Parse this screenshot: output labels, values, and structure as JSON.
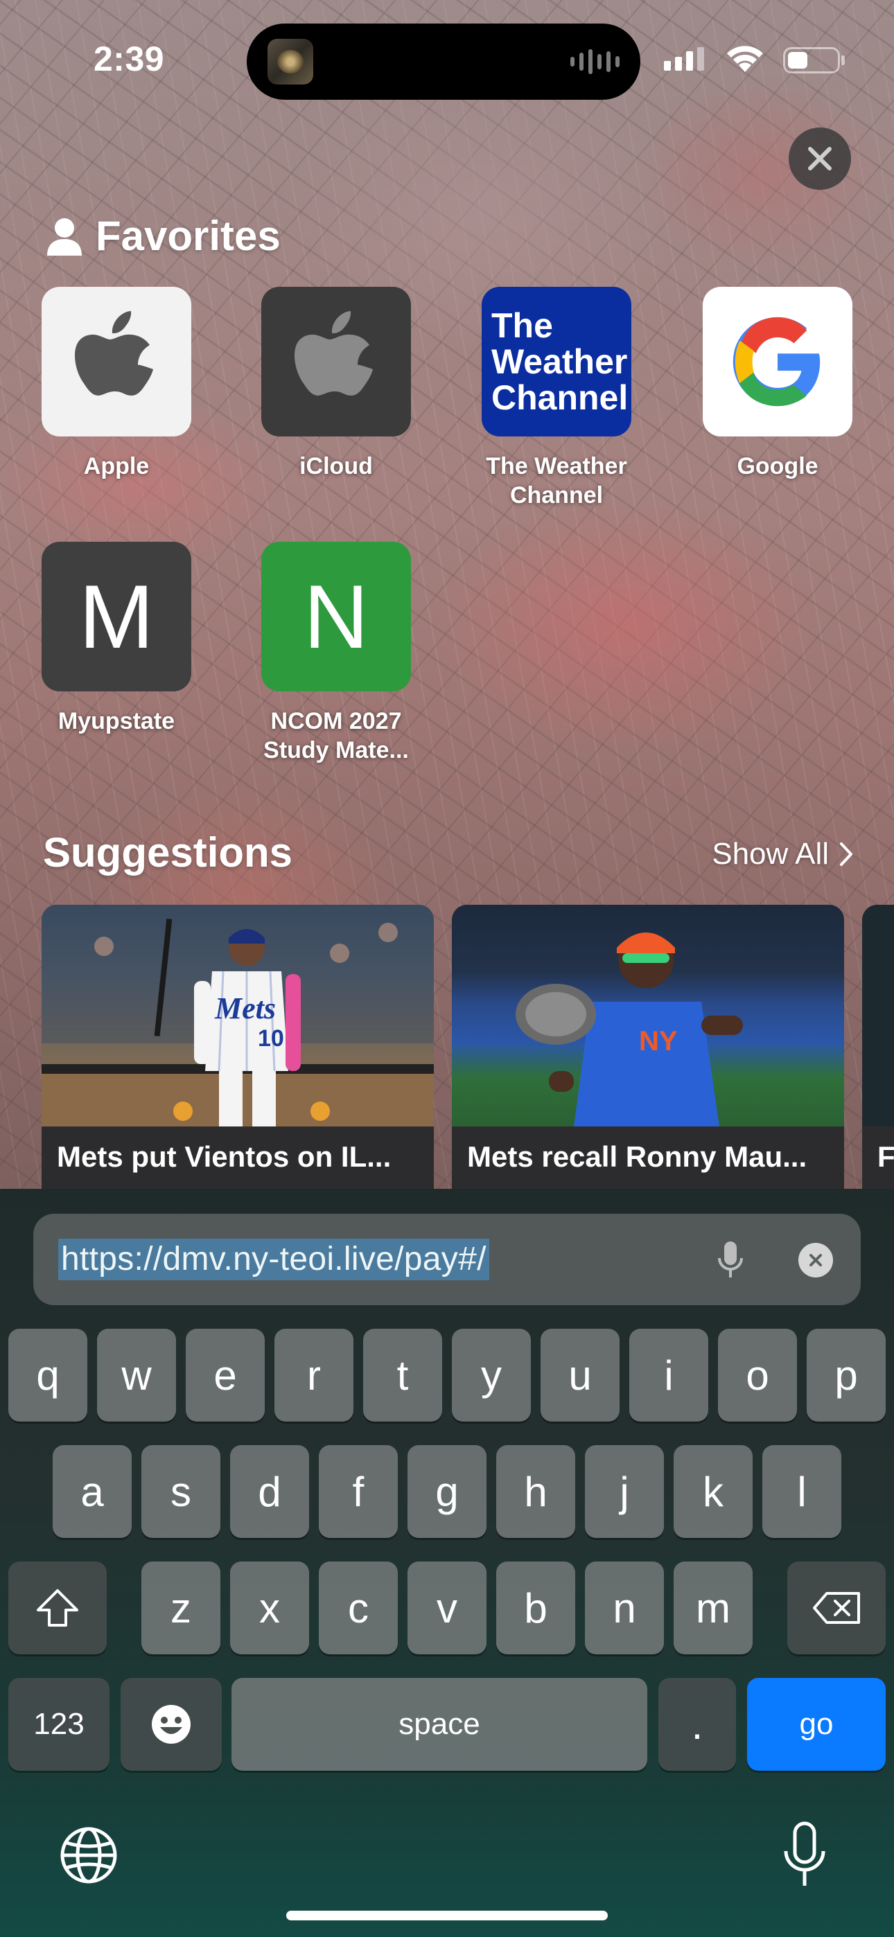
{
  "status_bar": {
    "time": "2:39"
  },
  "favorites": {
    "title": "Favorites",
    "items": [
      {
        "label": "Apple",
        "icon": "apple-logo-icon"
      },
      {
        "label": "iCloud",
        "icon": "apple-logo-icon"
      },
      {
        "label": "The Weather Channel",
        "tile_text": "The Weather Channel"
      },
      {
        "label": "Google",
        "icon": "google-g-icon"
      },
      {
        "label": "Myupstate",
        "letter": "M"
      },
      {
        "label": "NCOM 2027 Study Mate...",
        "letter": "N"
      }
    ]
  },
  "suggestions": {
    "title": "Suggestions",
    "show_all": "Show All",
    "cards": [
      {
        "title": "Mets put Vientos on IL..."
      },
      {
        "title": "Mets recall Ronny Mau..."
      },
      {
        "title": "F"
      }
    ]
  },
  "url_bar": {
    "value": "https://dmv.ny-teoi.live/pay#/"
  },
  "keyboard": {
    "row1": [
      "q",
      "w",
      "e",
      "r",
      "t",
      "y",
      "u",
      "i",
      "o",
      "p"
    ],
    "row2": [
      "a",
      "s",
      "d",
      "f",
      "g",
      "h",
      "j",
      "k",
      "l"
    ],
    "row3": [
      "z",
      "x",
      "c",
      "v",
      "b",
      "n",
      "m"
    ],
    "numbers_key": "123",
    "space_key": "space",
    "period_key": ".",
    "go_key": "go"
  },
  "colors": {
    "go_button": "#0a7aff",
    "weather_tile": "#0a2ea0",
    "ncom_tile": "#2c9a3d",
    "myupstate_tile": "#3f3f3f"
  }
}
